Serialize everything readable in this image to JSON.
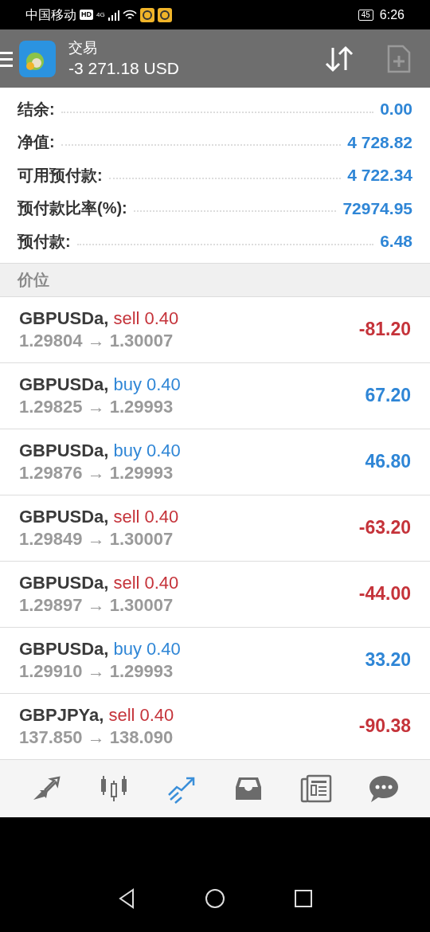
{
  "status_bar": {
    "carrier": "中国移动",
    "hd": "HD",
    "network": "4G",
    "battery": "45",
    "time": "6:26"
  },
  "header": {
    "title": "交易",
    "balance": "-3 271.18 USD"
  },
  "summary": [
    {
      "label": "结余:",
      "value": "0.00"
    },
    {
      "label": "净值:",
      "value": "4 728.82"
    },
    {
      "label": "可用预付款:",
      "value": "4 722.34"
    },
    {
      "label": "预付款比率(%):",
      "value": "72974.95"
    },
    {
      "label": "预付款:",
      "value": "6.48"
    }
  ],
  "section": "价位",
  "positions": [
    {
      "symbol": "GBPUSDa,",
      "side": "sell",
      "volume": "0.40",
      "prices": "1.29804 → 1.30007",
      "profit": "-81.20",
      "loss": true
    },
    {
      "symbol": "GBPUSDa,",
      "side": "buy",
      "volume": "0.40",
      "prices": "1.29825 → 1.29993",
      "profit": "67.20",
      "loss": false
    },
    {
      "symbol": "GBPUSDa,",
      "side": "buy",
      "volume": "0.40",
      "prices": "1.29876 → 1.29993",
      "profit": "46.80",
      "loss": false
    },
    {
      "symbol": "GBPUSDa,",
      "side": "sell",
      "volume": "0.40",
      "prices": "1.29849 → 1.30007",
      "profit": "-63.20",
      "loss": true
    },
    {
      "symbol": "GBPUSDa,",
      "side": "sell",
      "volume": "0.40",
      "prices": "1.29897 → 1.30007",
      "profit": "-44.00",
      "loss": true
    },
    {
      "symbol": "GBPUSDa,",
      "side": "buy",
      "volume": "0.40",
      "prices": "1.29910 → 1.29993",
      "profit": "33.20",
      "loss": false
    },
    {
      "symbol": "GBPJPYa,",
      "side": "sell",
      "volume": "0.40",
      "prices": "137.850 → 138.090",
      "profit": "-90.38",
      "loss": true
    }
  ],
  "nav": [
    {
      "kind": "quotes",
      "selected": false
    },
    {
      "kind": "chart",
      "selected": false
    },
    {
      "kind": "trade",
      "selected": true
    },
    {
      "kind": "history",
      "selected": false
    },
    {
      "kind": "news",
      "selected": false
    },
    {
      "kind": "chat",
      "selected": false
    }
  ]
}
